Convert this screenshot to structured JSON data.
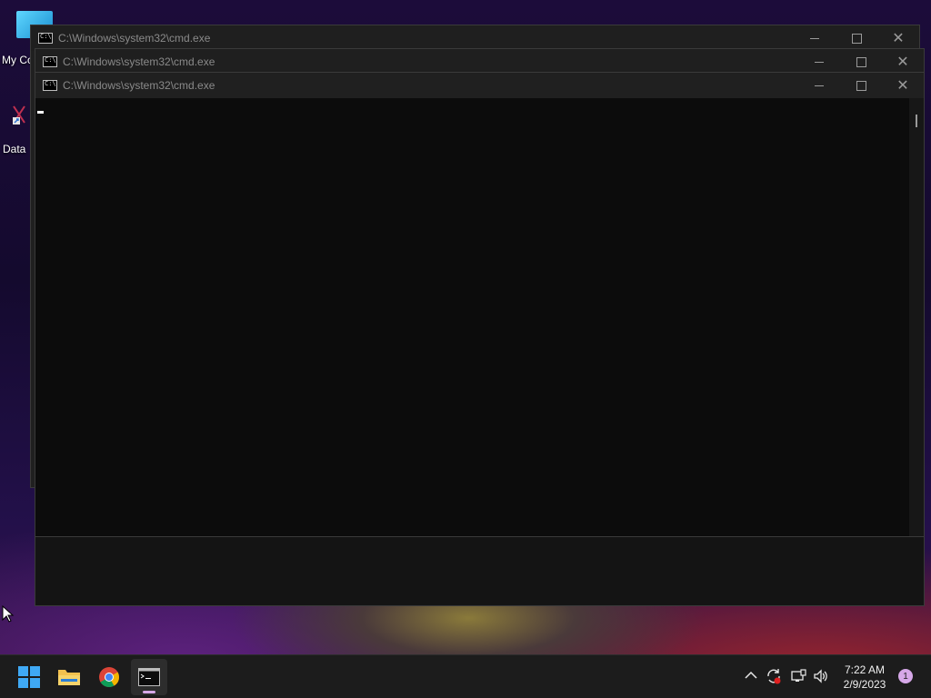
{
  "desktop": {
    "icons": [
      {
        "label": "My Co",
        "icon": "computer-icon"
      },
      {
        "label": "Data",
        "icon": "shortcut-icon"
      }
    ]
  },
  "windows": [
    {
      "title": "C:\\Windows\\system32\\cmd.exe"
    },
    {
      "title": "C:\\Windows\\system32\\cmd.exe"
    },
    {
      "title": "C:\\Windows\\system32\\cmd.exe"
    }
  ],
  "taskbar": {
    "apps": [
      {
        "name": "Start",
        "icon": "windows-start-icon"
      },
      {
        "name": "File Explorer",
        "icon": "folder-icon"
      },
      {
        "name": "Google Chrome",
        "icon": "chrome-icon"
      },
      {
        "name": "Command Prompt",
        "icon": "cmd-icon"
      }
    ],
    "tray": {
      "time": "7:22 AM",
      "date": "2/9/2023",
      "notification_count": "1"
    }
  },
  "colors": {
    "console_bg": "#0c0c0c",
    "titlebar_bg": "#202020",
    "taskbar_bg": "#1c1c1c",
    "accent": "#d6a8e8"
  }
}
